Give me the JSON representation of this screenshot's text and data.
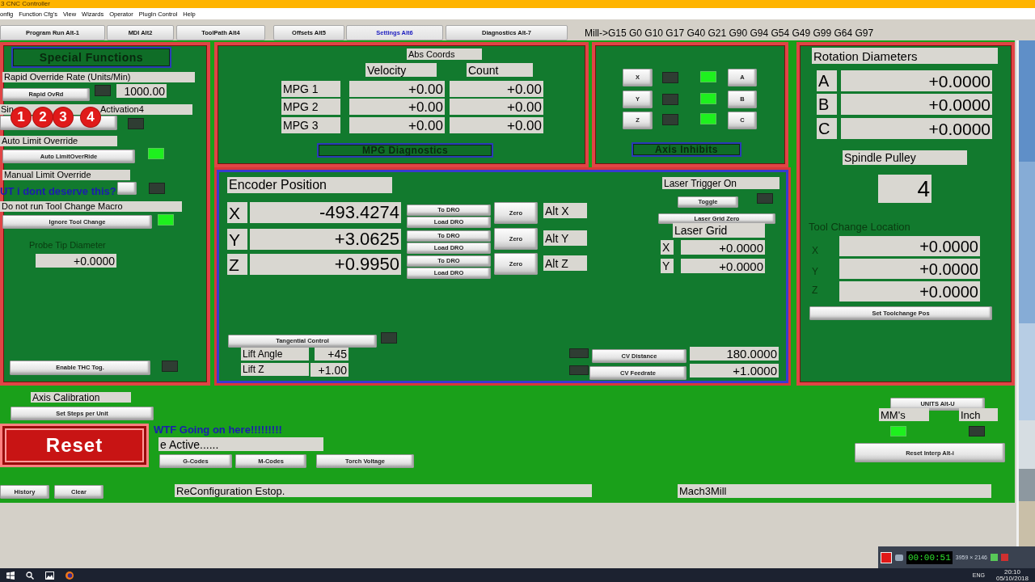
{
  "window": {
    "title": "3 CNC Controller"
  },
  "menu": [
    "onfig",
    "Function Cfg's",
    "View",
    "Wizards",
    "Operator",
    "PlugIn Control",
    "Help"
  ],
  "tabs": [
    {
      "label": "Program Run Alt-1",
      "selected": false
    },
    {
      "label": "MDI Alt2",
      "selected": false
    },
    {
      "label": "ToolPath Alt4",
      "selected": false
    },
    {
      "label": "Offsets Alt5",
      "selected": false
    },
    {
      "label": "Settings Alt6",
      "selected": true
    },
    {
      "label": "Diagnostics Alt-7",
      "selected": false
    }
  ],
  "modal_line": "Mill->G15  G0 G10 G17 G40 G21 G90 G94 G54 G49 G99 G64 G97",
  "special_functions": {
    "title": "Special Functions",
    "rapid_label": "Rapid Override Rate (Units/Min)",
    "rapid_button": "Rapid OvRd",
    "rapid_led": false,
    "rapid_value": "1000.00",
    "single_step_label_start": "Sin",
    "single_step_label_end": "Activation4",
    "single_step_led": false,
    "auto_limit_label": "Auto Limit Override",
    "auto_limit_button": "Auto LimitOverRide",
    "auto_limit_led": true,
    "manual_limit_label": "Manual Limit Override",
    "manual_limit_led": false,
    "tool_change_label": "Do not run Tool Change Macro",
    "tool_change_button": "Ignore Tool Change",
    "tool_change_led": true,
    "probe_label": "Probe Tip Diameter",
    "probe_value": "+0.0000",
    "thc_button": "Enable THC Tog.",
    "thc_led": false
  },
  "annotation_markers": [
    "1",
    "2",
    "3",
    "4"
  ],
  "overlay_caption": "UT i dont deserve this?",
  "mpg": {
    "title": "MPG Diagnostics",
    "header": "Abs Coords",
    "columns": [
      "Velocity",
      "Count"
    ],
    "rows": [
      {
        "name": "MPG 1",
        "velocity": "+0.00",
        "count": "+0.00"
      },
      {
        "name": "MPG 2",
        "velocity": "+0.00",
        "count": "+0.00"
      },
      {
        "name": "MPG 3",
        "velocity": "+0.00",
        "count": "+0.00"
      }
    ]
  },
  "axis_inhibits": {
    "title": "Axis Inhibits",
    "left": [
      {
        "label": "X",
        "on": false
      },
      {
        "label": "Y",
        "on": false
      },
      {
        "label": "Z",
        "on": false
      }
    ],
    "right": [
      {
        "label": "A",
        "on": true
      },
      {
        "label": "B",
        "on": true
      },
      {
        "label": "C",
        "on": true
      }
    ]
  },
  "encoder": {
    "title": "Encoder Position",
    "axes": [
      {
        "axis": "X",
        "value": "-493.4274",
        "to_dro": "To DRO",
        "load_dro": "Load DRO",
        "zero": "Zero",
        "alt": "Alt X"
      },
      {
        "axis": "Y",
        "value": "+3.0625",
        "to_dro": "To DRO",
        "load_dro": "Load DRO",
        "zero": "Zero",
        "alt": "Alt Y"
      },
      {
        "axis": "Z",
        "value": "+0.9950",
        "to_dro": "To DRO",
        "load_dro": "Load DRO",
        "zero": "Zero",
        "alt": "Alt Z"
      }
    ],
    "laser_trigger_label": "Laser Trigger On",
    "toggle_button": "Toggle",
    "toggle_led": false,
    "laser_grid_zero": "Laser Grid Zero",
    "laser_grid_label": "Laser Grid",
    "laser_grid": [
      {
        "axis": "X",
        "value": "+0.0000"
      },
      {
        "axis": "Y",
        "value": "+0.0000"
      }
    ],
    "tangential_button": "Tangential Control",
    "tangential_led": false,
    "lift_angle_label": "Lift Angle",
    "lift_angle": "+45",
    "lift_z_label": "Lift Z",
    "lift_z": "+1.00",
    "cv_distance_led": false,
    "cv_distance_button": "CV Distance",
    "cv_distance": "180.0000",
    "cv_feedrate_led": false,
    "cv_feedrate_button": "CV Feedrate",
    "cv_feedrate": "+1.0000"
  },
  "rotation": {
    "title": "Rotation Diameters",
    "rows": [
      {
        "axis": "A",
        "value": "+0.0000"
      },
      {
        "axis": "B",
        "value": "+0.0000"
      },
      {
        "axis": "C",
        "value": "+0.0000"
      }
    ],
    "spindle_pulley_label": "Spindle Pulley",
    "spindle_pulley": "4",
    "tool_change_title": "Tool Change Location",
    "tool_change": [
      {
        "axis": "X",
        "value": "+0.0000"
      },
      {
        "axis": "Y",
        "value": "+0.0000"
      },
      {
        "axis": "Z",
        "value": "+0.0000"
      }
    ],
    "set_button": "Set Toolchange Pos"
  },
  "bottom": {
    "axis_calibration_label": "Axis Calibration",
    "set_steps_button": "Set Steps per Unit",
    "reset_button": "Reset",
    "status_caption": "WTF Going on here!!!!!!!!!",
    "mode_field": "e Active......",
    "gcodes_button": "G-Codes",
    "mcodes_button": "M-Codes",
    "torch_button": "Torch Voltage",
    "history_button": "History",
    "clear_button": "Clear",
    "status_message": "ReConfiguration Estop.",
    "profile": "Mach3Mill",
    "units_button": "UNITS Alt-U",
    "mm_label": "MM's",
    "mm_led": true,
    "inch_label": "Inch",
    "inch_led": false,
    "reset_interp_button": "Reset Interp Alt-i"
  },
  "recorder": {
    "timer": "00:00:51",
    "resolution": "3959 × 2146"
  },
  "taskbar": {
    "language": "ENG",
    "time": "20:10",
    "date": "05/10/2018"
  }
}
